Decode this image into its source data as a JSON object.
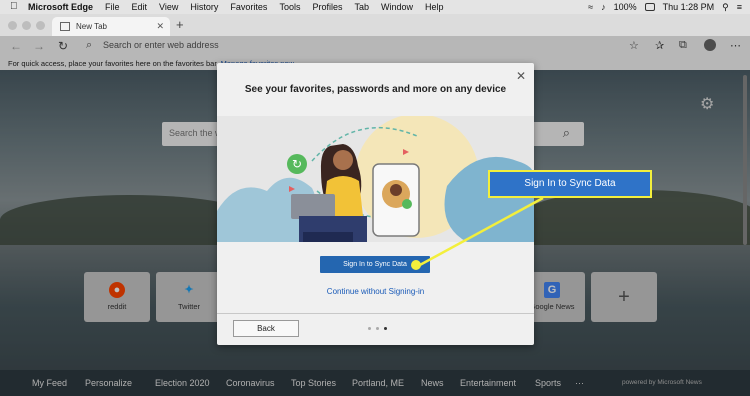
{
  "menubar": {
    "app_name": "Microsoft Edge",
    "items": [
      "File",
      "Edit",
      "View",
      "History",
      "Favorites",
      "Tools",
      "Profiles",
      "Tab",
      "Window",
      "Help"
    ],
    "battery": "100%",
    "clock": "Thu 1:28 PM"
  },
  "tab": {
    "title": "New Tab",
    "new_tab": "+"
  },
  "address_bar": {
    "placeholder": "Search or enter web address"
  },
  "favorites_bar": {
    "text": "For quick access, place your favorites here on the favorites bar.",
    "link": "Manage favorites now"
  },
  "search": {
    "placeholder": "Search the w"
  },
  "quick_links": [
    {
      "label": "reddit",
      "icon": "reddit-icon"
    },
    {
      "label": "Twitter",
      "icon": "twitter-icon"
    },
    {
      "label": "Google News",
      "icon": "google-news-icon"
    }
  ],
  "news_nav": {
    "items": [
      "My Feed",
      "Personalize",
      "Election 2020",
      "Coronavirus",
      "Top Stories",
      "Portland, ME",
      "News",
      "Entertainment",
      "Sports",
      "···"
    ],
    "powered": "powered by Microsoft News"
  },
  "modal": {
    "title": "See your favorites, passwords and more on any device",
    "sign_in": "Sign In to Sync Data",
    "continue": "Continue without Signing-in",
    "back": "Back"
  },
  "callout": {
    "label": "Sign In to Sync Data",
    "color": "#2f73c8",
    "border": "#f3ef3c"
  }
}
